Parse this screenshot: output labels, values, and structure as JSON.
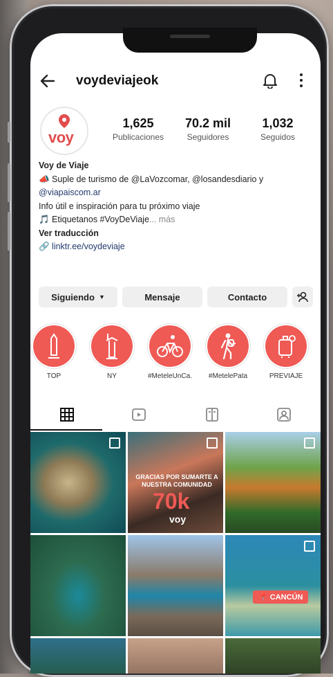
{
  "header": {
    "username": "voydeviajeok"
  },
  "profile": {
    "avatar_text": "voy",
    "stats": [
      {
        "value": "1,625",
        "label": "Publicaciones"
      },
      {
        "value": "70.2 mil",
        "label": "Seguidores"
      },
      {
        "value": "1,032",
        "label": "Seguidos"
      }
    ]
  },
  "bio": {
    "name": "Voy de Viaje",
    "line1": "Suple de turismo de @LaVozcomar, @losandesdiario y",
    "line2": "@viapaiscom.ar",
    "line3": "Info útil e inspiración para tu próximo viaje",
    "line4": "Etiquetanos #VoyDeViaje",
    "more": "... más",
    "translate": "Ver traducción",
    "link": "linktr.ee/voydeviaje"
  },
  "actions": {
    "following": "Siguiendo",
    "message": "Mensaje",
    "contact": "Contacto"
  },
  "highlights": [
    {
      "label": "TOP"
    },
    {
      "label": "NY"
    },
    {
      "label": "#MeteleUnCa..."
    },
    {
      "label": "#MetelePata"
    },
    {
      "label": "PREVIAJE"
    }
  ],
  "grid": {
    "post2_title": "GRACIAS POR SUMARTE A NUESTRA COMUNIDAD",
    "post2_big": "70k",
    "post2_brand": "voy",
    "post6_tag": "CANCÚN"
  },
  "colors": {
    "accent": "#ef5a55",
    "link": "#223a6c"
  },
  "icons": [
    "back-arrow-icon",
    "bell-icon",
    "more-vertical-icon",
    "add-user-icon",
    "grid-icon",
    "reels-icon",
    "guides-icon",
    "tagged-icon"
  ]
}
